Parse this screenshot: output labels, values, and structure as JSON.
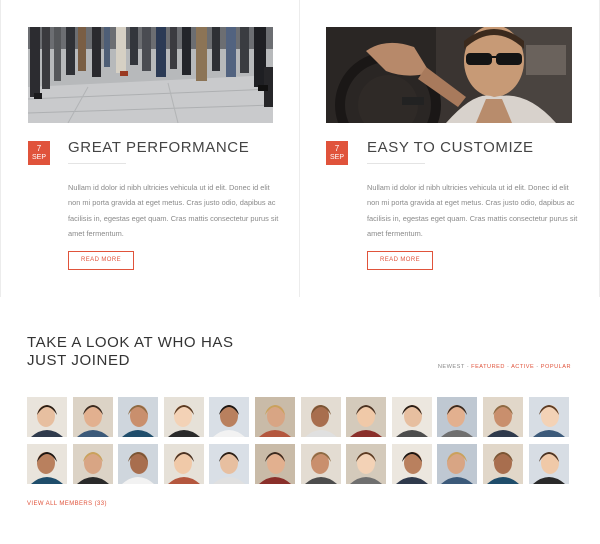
{
  "cards": [
    {
      "title": "GREAT PERFORMANCE",
      "date_day": "7",
      "date_month": "SEP",
      "body": "Nullam id dolor id nibh ultricies vehicula ut id elit. Donec id elit non mi porta gravida at eget metus. Cras justo odio, dapibus ac facilisis in, egestas eget quam. Cras mattis consectetur purus sit amet fermentum.",
      "button_label": "READ MORE"
    },
    {
      "title": "EASY TO CUSTOMIZE",
      "date_day": "7",
      "date_month": "SEP",
      "body": "Nullam id dolor id nibh ultricies vehicula ut id elit. Donec id elit non mi porta gravida at eget metus. Cras justo odio, dapibus ac facilisis in, egestas eget quam. Cras mattis consectetur purus sit amet fermentum.",
      "button_label": "READ MORE"
    }
  ],
  "members": {
    "title_line1": "TAKE A LOOK AT WHO HAS",
    "title_line2": "JUST JOINED",
    "filters": [
      {
        "label": "NEWEST",
        "active": false
      },
      {
        "label": "FEATURED",
        "active": true
      },
      {
        "label": "ACTIVE",
        "active": true
      },
      {
        "label": "POPULAR",
        "active": true
      }
    ],
    "filter_separator": " - ",
    "view_all_label": "VIEW ALL MEMBERS (33)",
    "avatar_count": 24
  },
  "colors": {
    "accent": "#e0533b",
    "text_dark": "#444444",
    "text_muted": "#8a8a8a",
    "border": "#ececec"
  }
}
